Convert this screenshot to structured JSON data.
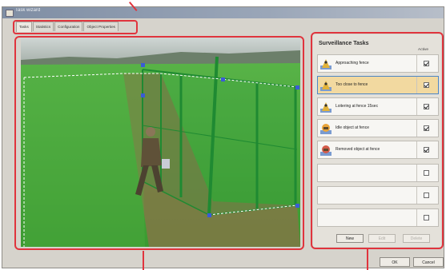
{
  "window": {
    "title": "Task wizard"
  },
  "tabs": [
    {
      "label": "Tasks",
      "active": true
    },
    {
      "label": "Statistics",
      "active": false
    },
    {
      "label": "Configuration",
      "active": false
    },
    {
      "label": "Object Properties",
      "active": false
    }
  ],
  "panel": {
    "title": "Surveillance Tasks",
    "active_header": "Active",
    "tasks": [
      {
        "label": "Approaching fence",
        "icon": "person-fence-icon",
        "active": true,
        "selected": false
      },
      {
        "label": "Too close to fence",
        "icon": "person-fence-icon",
        "active": true,
        "selected": true
      },
      {
        "label": "Loitering at fence 15sec",
        "icon": "person-fence-icon",
        "active": true,
        "selected": false
      },
      {
        "label": "Idle object at fence",
        "icon": "idle-object-icon",
        "active": true,
        "selected": false
      },
      {
        "label": "Removed object at fence",
        "icon": "removed-object-icon",
        "active": true,
        "selected": false
      },
      {
        "label": "",
        "icon": "",
        "active": false,
        "selected": false
      },
      {
        "label": "",
        "icon": "",
        "active": false,
        "selected": false
      },
      {
        "label": "",
        "icon": "",
        "active": false,
        "selected": false
      }
    ],
    "buttons": {
      "new": "New",
      "edit": "Edit",
      "delete": "Delete"
    }
  },
  "dialog_buttons": {
    "ok": "OK",
    "cancel": "Cancel"
  },
  "colors": {
    "callout": "#e0343d",
    "selected_row": "#f2d9a0",
    "grass": "#45a83a",
    "fence": "#1f8a32"
  }
}
